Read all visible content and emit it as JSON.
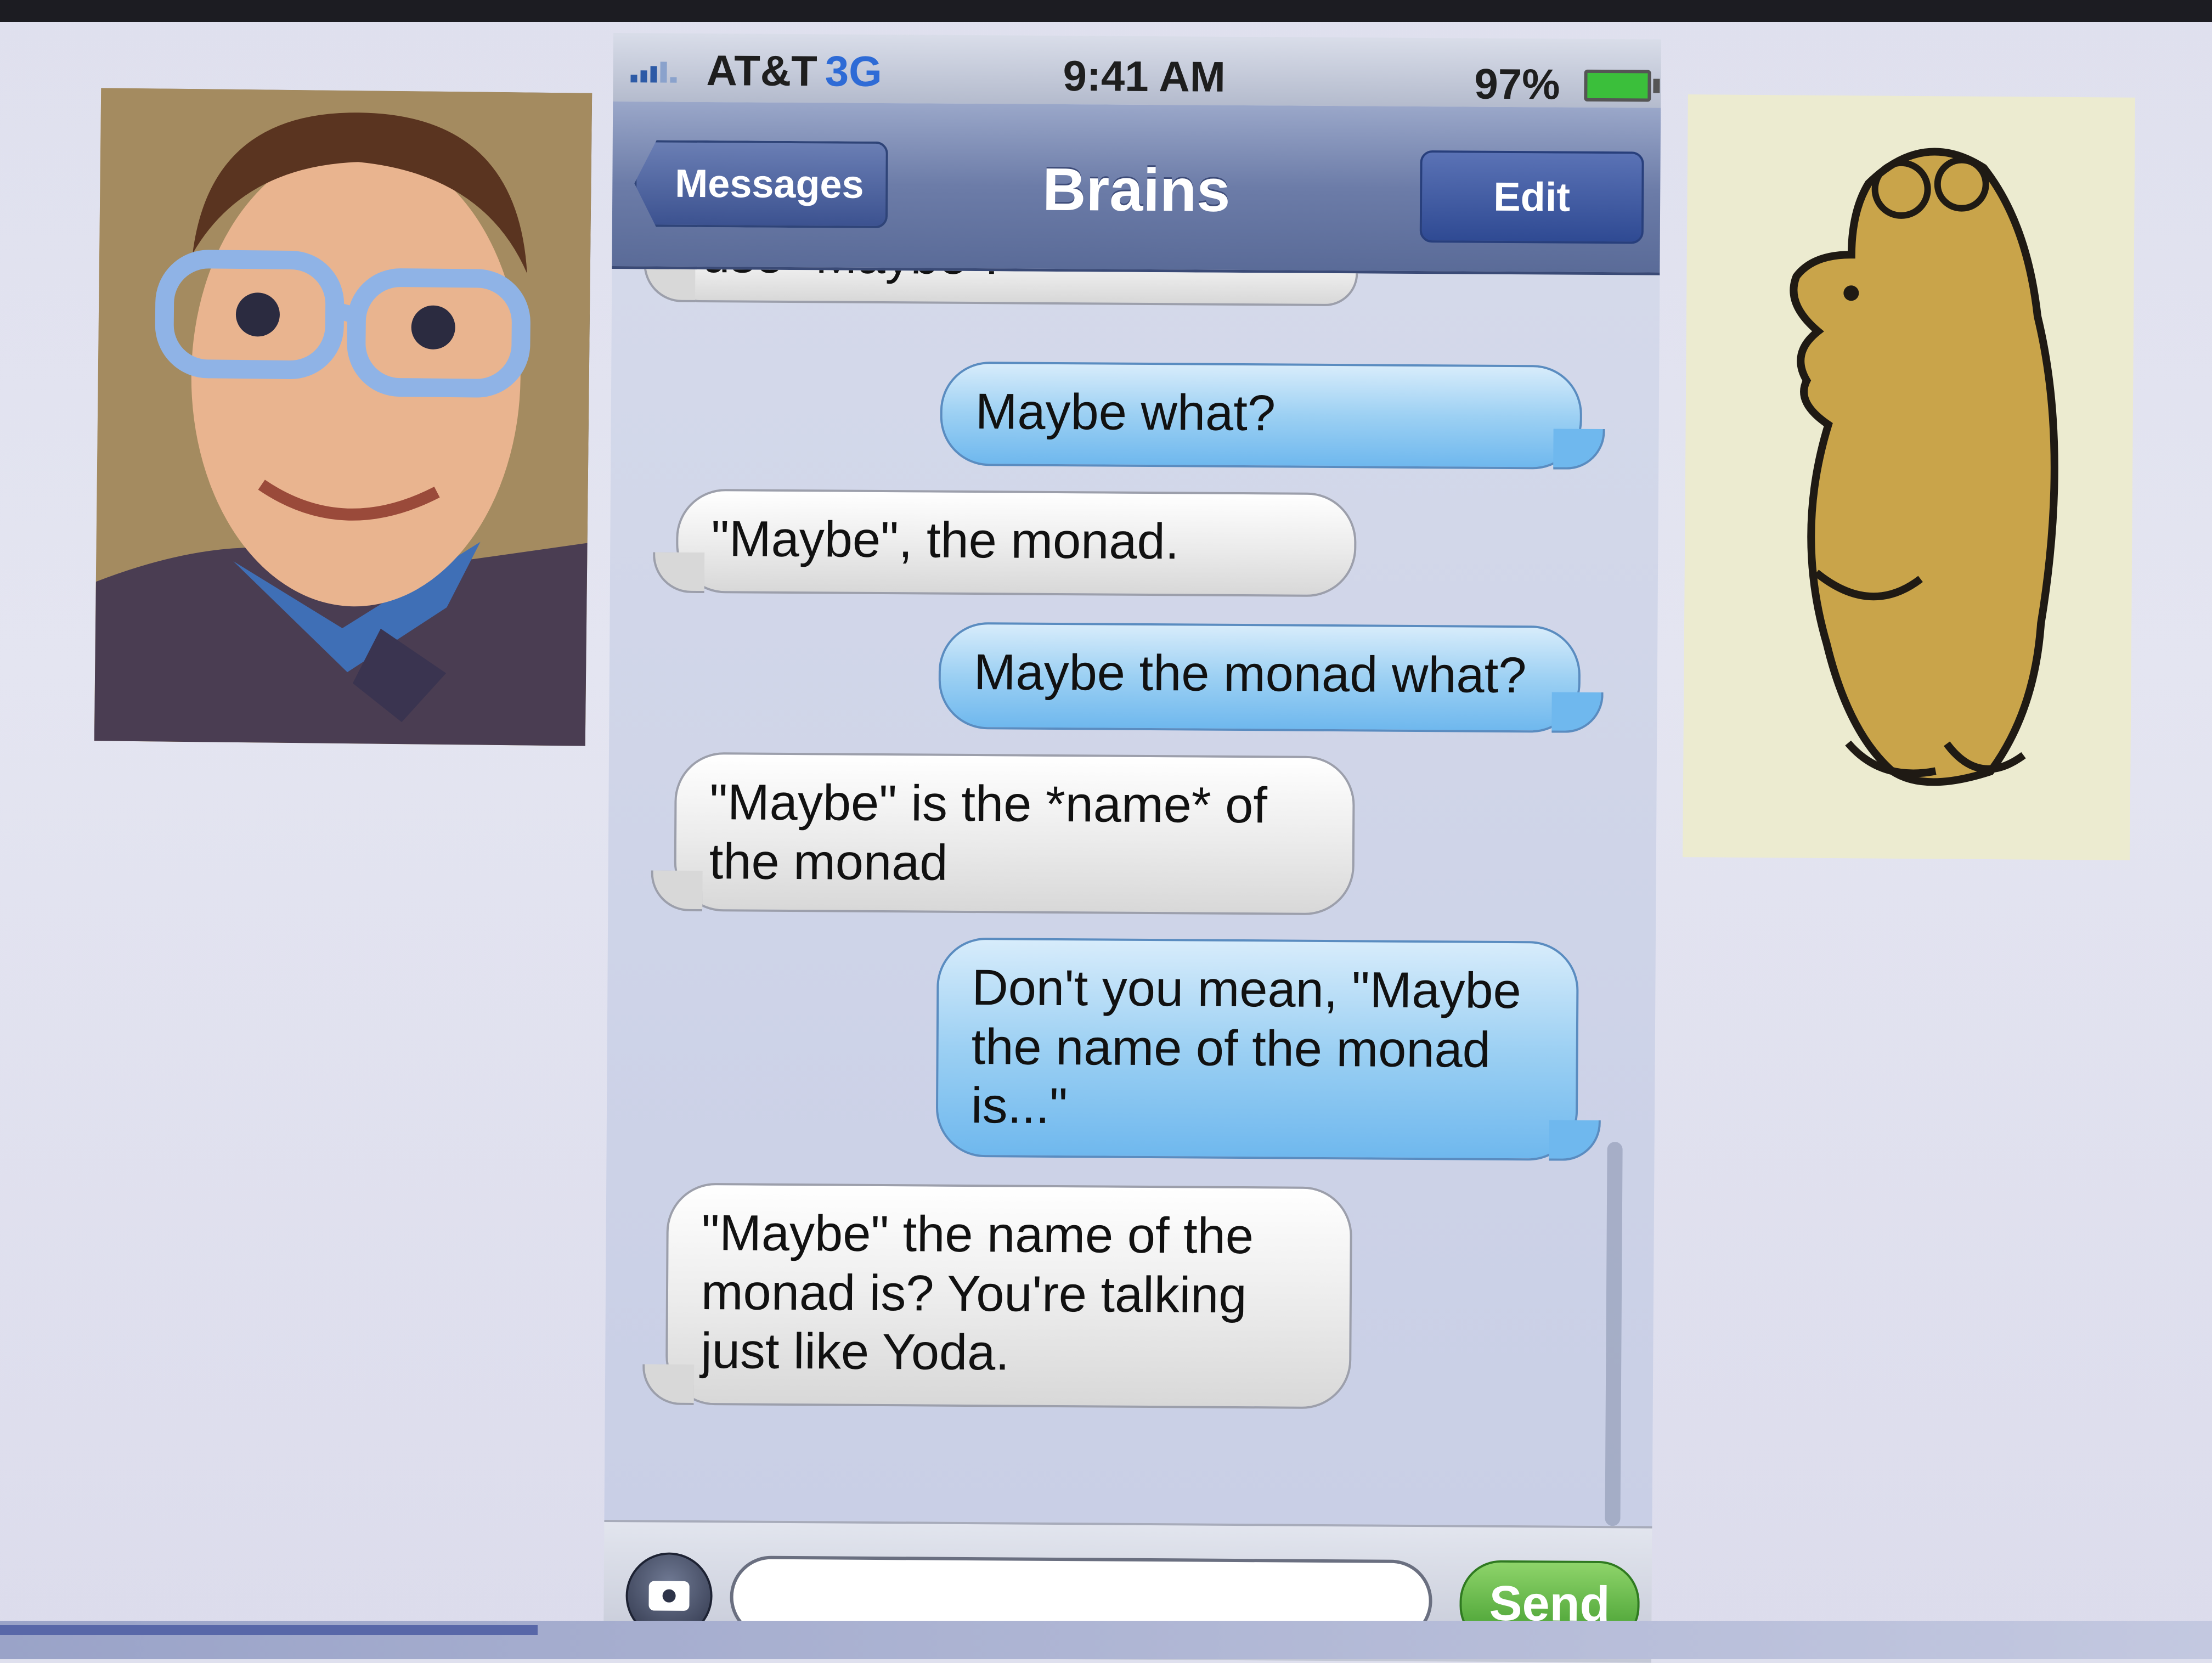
{
  "status_bar": {
    "carrier": "AT&T",
    "network": "3G",
    "time": "9:41 AM",
    "battery": "97%"
  },
  "nav": {
    "back_label": "Messages",
    "title": "Brains",
    "edit_label": "Edit"
  },
  "messages": [
    {
      "side": "received",
      "text": "use \"Maybe\"."
    },
    {
      "side": "sent",
      "text": "Maybe what?"
    },
    {
      "side": "received",
      "text": "\"Maybe\", the monad."
    },
    {
      "side": "sent",
      "text": "Maybe the monad what?"
    },
    {
      "side": "received",
      "text": "\"Maybe\" is the *name* of the monad"
    },
    {
      "side": "sent",
      "text": "Don't you mean, \"Maybe the name of the monad is...\""
    },
    {
      "side": "received",
      "text": "\"Maybe\" the name of the monad is? You're talking just like Yoda."
    }
  ],
  "input": {
    "value": "",
    "send_label": "Send"
  },
  "colors": {
    "sent_bubble": "#9cd0f3",
    "received_bubble": "#ebebeb",
    "send_button": "#3f9a2c",
    "nav_bar": "#6c7ca8"
  },
  "images": {
    "left": "puppet-with-glasses-photo",
    "right": "teddy-bear-illustration"
  }
}
